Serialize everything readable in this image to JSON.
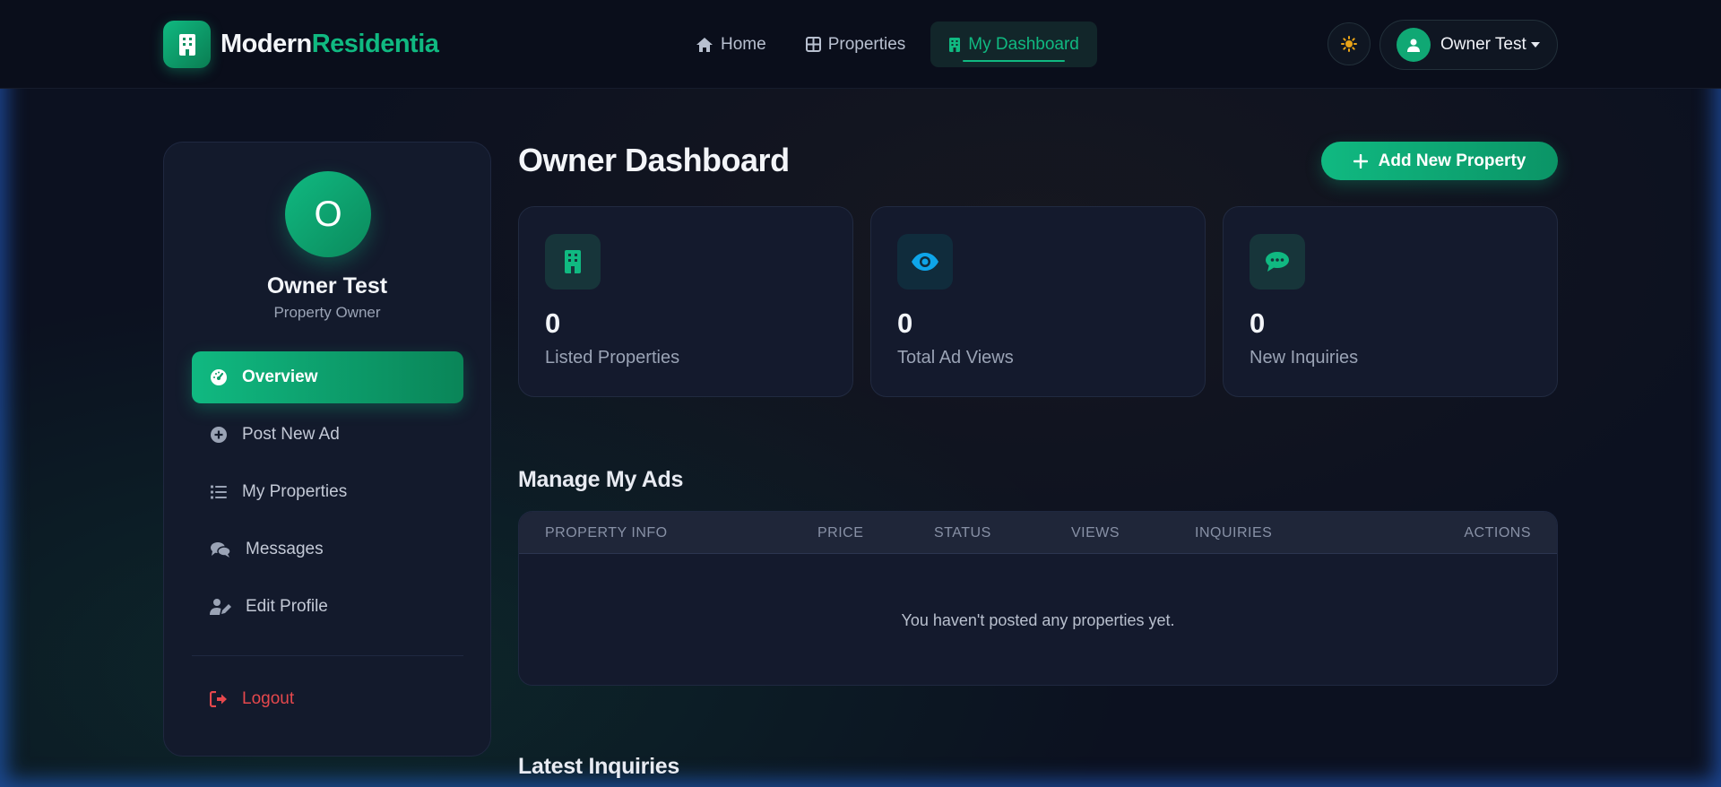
{
  "brand": {
    "name_part1": "Modern",
    "name_part2": "Residentia",
    "accent": "#10b981"
  },
  "nav": {
    "items": [
      {
        "label": "Home",
        "icon": "home-icon"
      },
      {
        "label": "Properties",
        "icon": "grid-icon"
      },
      {
        "label": "My Dashboard",
        "icon": "building-icon",
        "active": true
      }
    ]
  },
  "header": {
    "theme_icon": "sun-icon",
    "user_name": "Owner Test"
  },
  "profile": {
    "initial": "O",
    "name": "Owner Test",
    "role": "Property Owner"
  },
  "sidebar": {
    "items": [
      {
        "label": "Overview",
        "icon": "gauge-icon",
        "active": true
      },
      {
        "label": "Post New Ad",
        "icon": "plus-circle-icon"
      },
      {
        "label": "My Properties",
        "icon": "list-icon"
      },
      {
        "label": "Messages",
        "icon": "comments-icon"
      },
      {
        "label": "Edit Profile",
        "icon": "user-edit-icon"
      }
    ],
    "logout_label": "Logout"
  },
  "main": {
    "title": "Owner Dashboard",
    "add_button": "Add New Property",
    "stats": [
      {
        "value": "0",
        "label": "Listed Properties",
        "icon": "building-icon",
        "color": "#10b981"
      },
      {
        "value": "0",
        "label": "Total Ad Views",
        "icon": "eye-icon",
        "color": "#0ea5e9"
      },
      {
        "value": "0",
        "label": "New Inquiries",
        "icon": "comment-icon",
        "color": "#10b981"
      }
    ],
    "manage_title": "Manage My Ads",
    "table": {
      "columns": [
        "PROPERTY INFO",
        "PRICE",
        "STATUS",
        "VIEWS",
        "INQUIRIES",
        "ACTIONS"
      ],
      "empty_message": "You haven't posted any properties yet."
    },
    "inquiries_title": "Latest Inquiries"
  }
}
